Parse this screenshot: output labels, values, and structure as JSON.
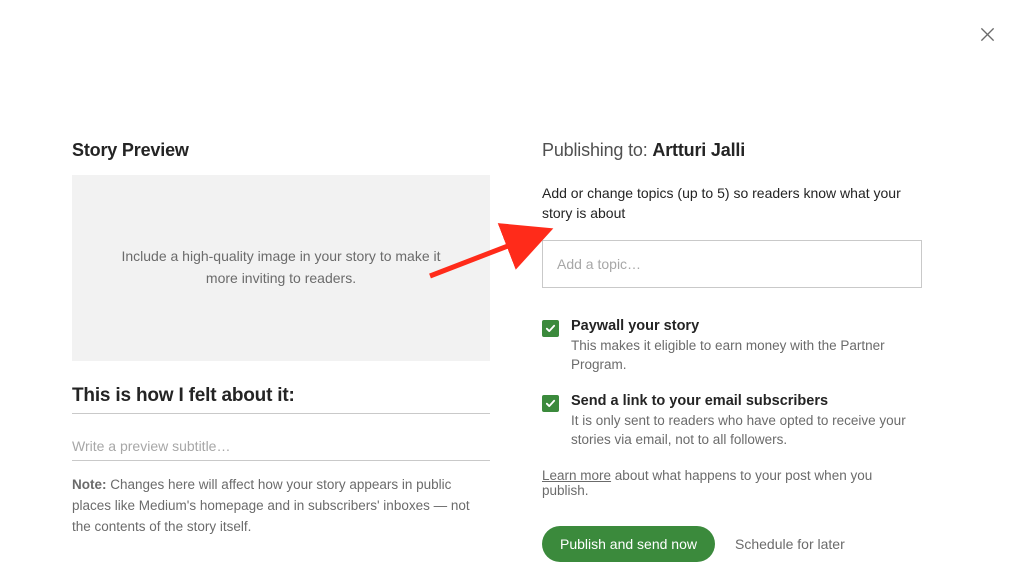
{
  "left": {
    "section_title": "Story Preview",
    "image_well_text": "Include a high-quality image in your story to make it more inviting to readers.",
    "preview_title": "This is how I felt about it:",
    "preview_subtitle_placeholder": "Write a preview subtitle…",
    "note_bold": "Note:",
    "note_text": " Changes here will affect how your story appears in public places like Medium's homepage and in subscribers' inboxes — not the contents of the story itself."
  },
  "right": {
    "publishing_to_label": "Publishing to: ",
    "publishing_to_name": "Artturi Jalli",
    "topics_label": "Add or change topics (up to 5) so readers know what your story is about",
    "topic_input_placeholder": "Add a topic…",
    "paywall": {
      "title": "Paywall your story",
      "subtitle": "This makes it eligible to earn money with the Partner Program."
    },
    "email": {
      "title": "Send a link to your email subscribers",
      "subtitle": "It is only sent to readers who have opted to receive your stories via email, not to all followers."
    },
    "learn_more_link": "Learn more",
    "learn_more_rest": " about what happens to your post when you publish.",
    "publish_button": "Publish and send now",
    "schedule_link": "Schedule for later"
  }
}
